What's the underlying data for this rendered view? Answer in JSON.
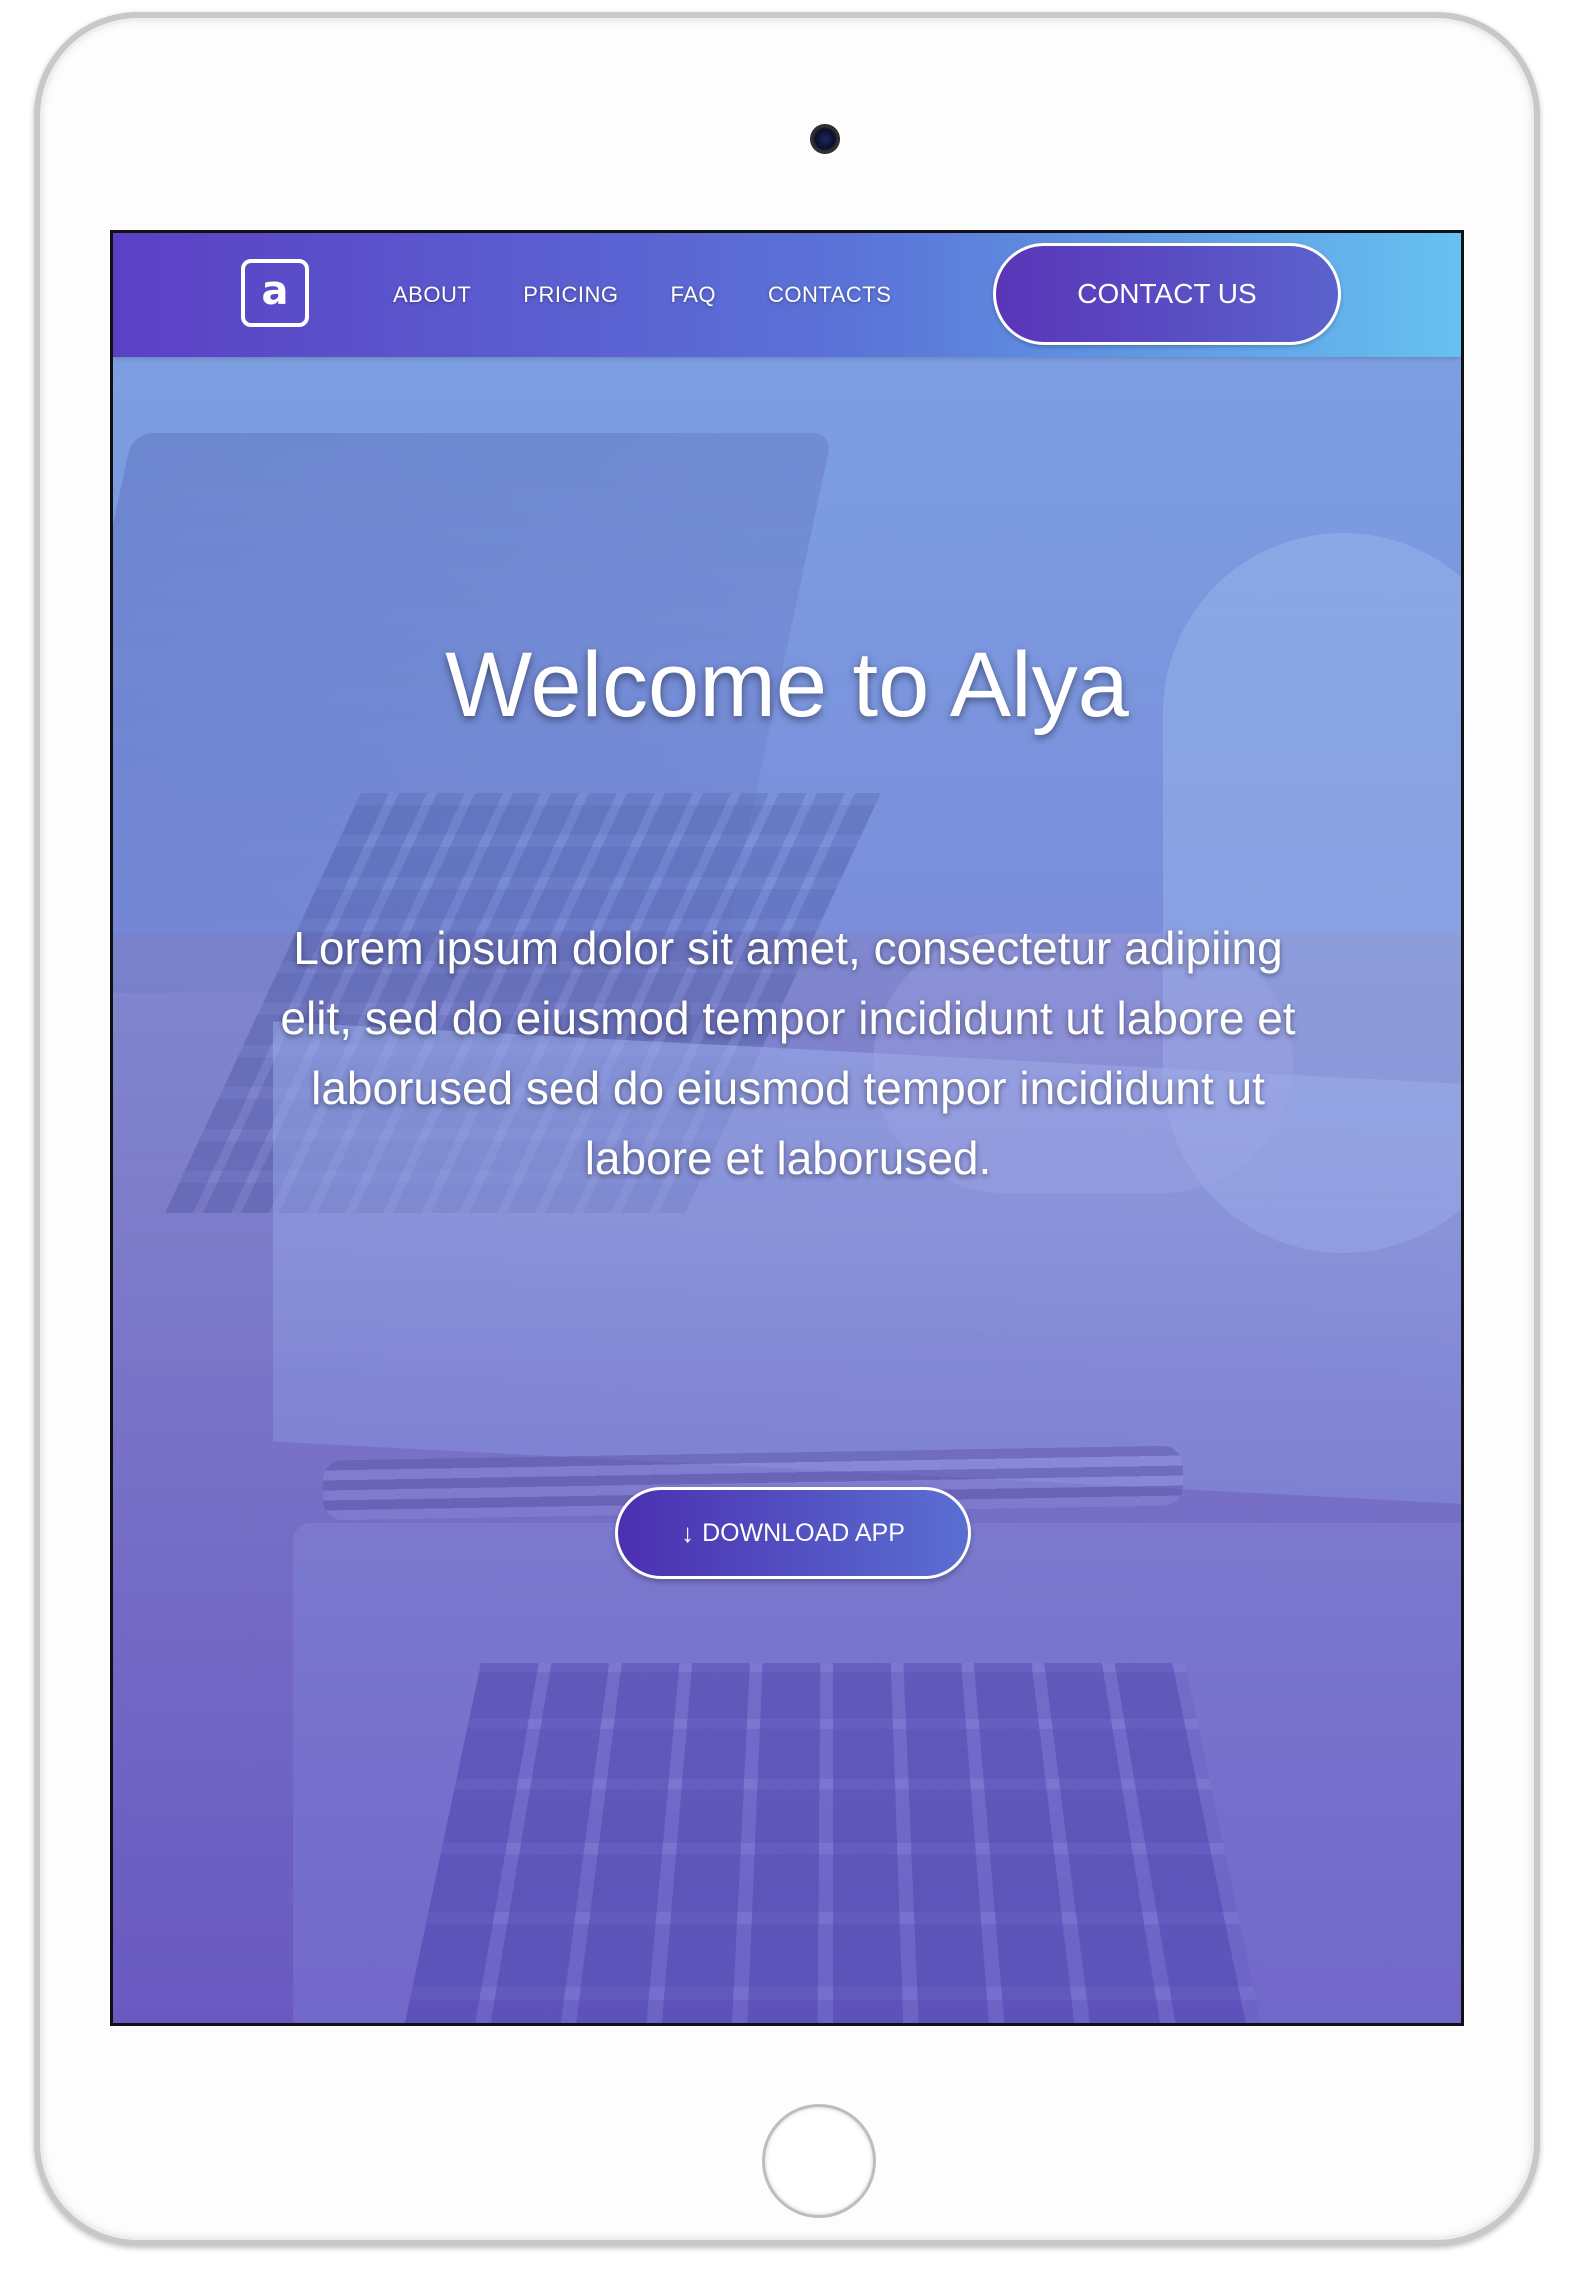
{
  "nav": {
    "logo_letter": "a",
    "links": [
      "ABOUT",
      "PRICING",
      "FAQ",
      "CONTACTS"
    ],
    "contact_button": "CONTACT US"
  },
  "hero": {
    "title": "Welcome to Alya",
    "text": "Lorem ipsum dolor sit amet, consectetur adipiing elit, sed do eiusmod tempor incididunt ut labore et laborused sed do eiusmod tempor incididunt ut labore et laborused.",
    "download_button": "DOWNLOAD APP",
    "download_icon": "arrow-down-icon"
  },
  "colors": {
    "nav_gradient_start": "#5b40c4",
    "nav_gradient_end": "#66c1f0",
    "button_gradient_start": "#4b2fb0",
    "text": "#ffffff"
  }
}
